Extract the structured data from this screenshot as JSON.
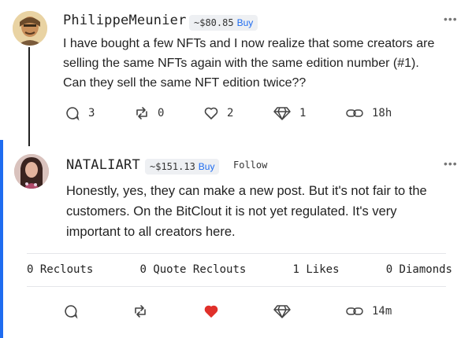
{
  "post1": {
    "username": "PhilippeMeunier",
    "price": "~$80.85",
    "buy_label": "Buy",
    "more": "•••",
    "text_lines": [
      "I have bought a few NFTs and I now realize that some creators are",
      "selling the same NFTs again with the same edition number (#1).",
      "Can they sell the same NFT edition twice??"
    ],
    "actions": {
      "comments": "3",
      "reclouts": "0",
      "likes": "2",
      "diamonds": "1",
      "time": "18h"
    }
  },
  "post2": {
    "username": "NATALIART",
    "price": "~$151.13",
    "buy_label": "Buy",
    "follow_label": "Follow",
    "more": "•••",
    "text_lines": [
      "Honestly, yes, they can make a new post. But it's not fair to the",
      "customers. On the BitClout it is not yet regulated. It's very",
      "important to all creators here."
    ],
    "stats": {
      "reclouts": "0 Reclouts",
      "quote_reclouts": "0 Quote Reclouts",
      "likes": "1 Likes",
      "diamonds": "0 Diamonds"
    },
    "actions": {
      "time": "14m"
    }
  },
  "colors": {
    "accent": "#1f6cf0",
    "like_active": "#e0302a",
    "text": "#222222"
  }
}
